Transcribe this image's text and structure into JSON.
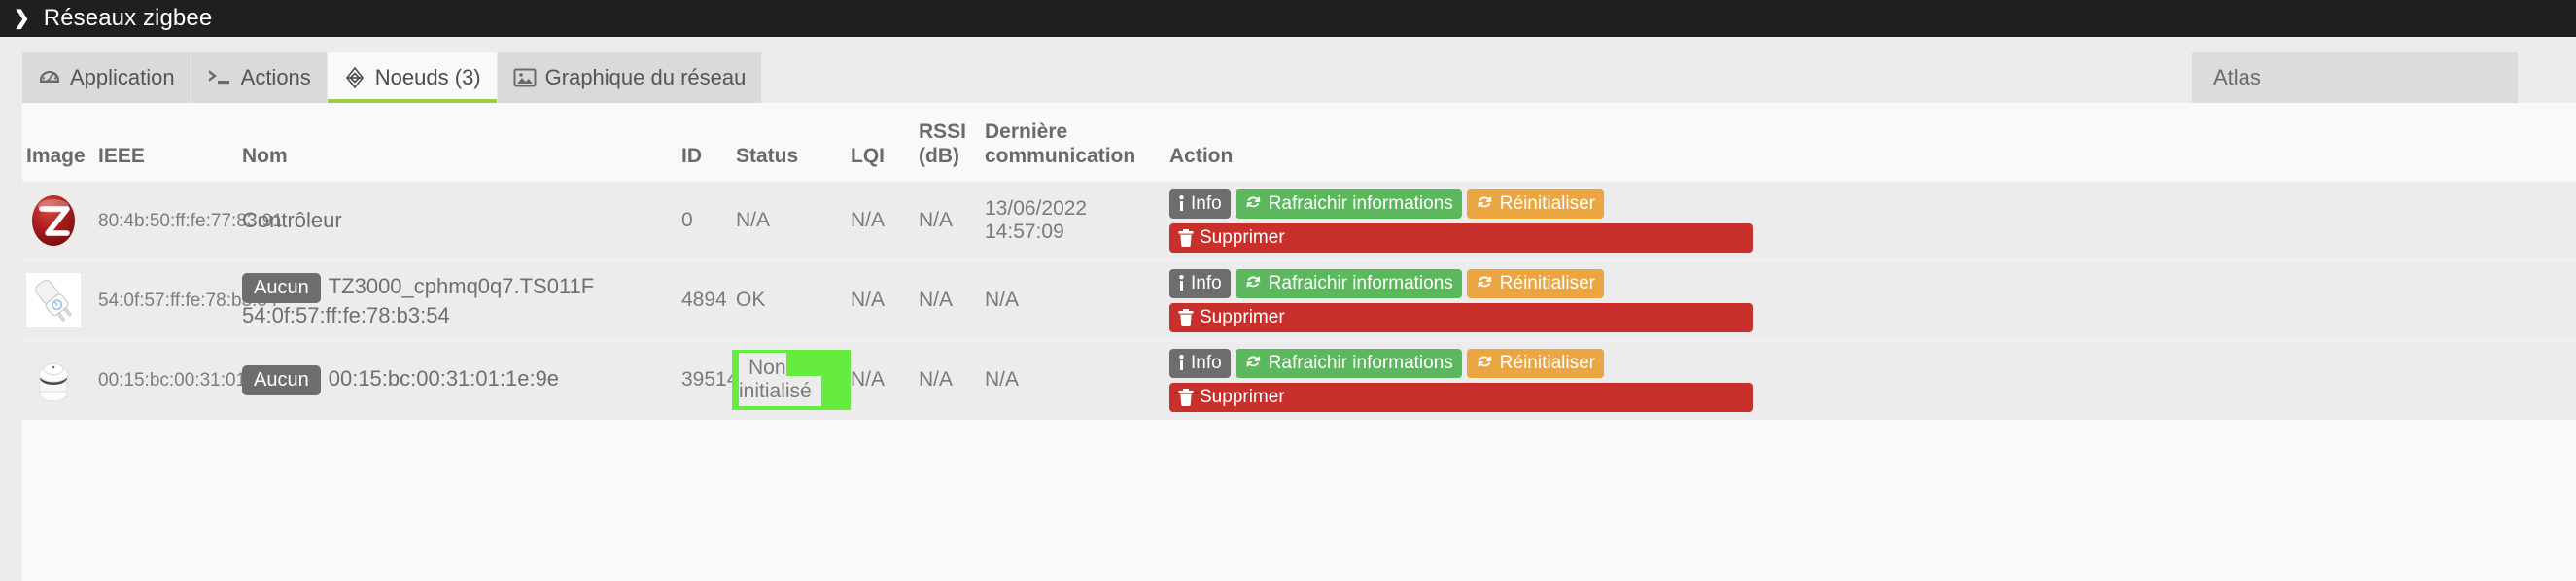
{
  "header": {
    "title": "Réseaux zigbee",
    "chevron_icon": "chevron-right-icon"
  },
  "tabs": [
    {
      "label": "Application",
      "icon": "dashboard-icon",
      "active": false
    },
    {
      "label": "Actions",
      "icon": "terminal-icon",
      "active": false
    },
    {
      "label": "Noeuds (3)",
      "icon": "zigbee-node-icon",
      "active": true
    },
    {
      "label": "Graphique du réseau",
      "icon": "image-icon",
      "active": false
    }
  ],
  "right_tab": {
    "label": "Atlas"
  },
  "table": {
    "columns": [
      "Image",
      "IEEE",
      "Nom",
      "ID",
      "Status",
      "LQI",
      "RSSI (dB)",
      "Dernière communication",
      "Action"
    ],
    "columns_multiline": {
      "rssi_line1": "RSSI",
      "rssi_line2": "(dB)",
      "last_line1": "Dernière",
      "last_line2": "communication"
    },
    "rows": [
      {
        "image_icon": "zigbee-logo-icon",
        "ieee": "80:4b:50:ff:fe:77:83:91",
        "badge": "",
        "name": "Contrôleur",
        "name_sub": "",
        "id": "0",
        "status": "N/A",
        "status_highlighted": false,
        "lqi": "N/A",
        "rssi": "N/A",
        "last_communication": "13/06/2022 14:57:09"
      },
      {
        "image_icon": "smart-plug-icon",
        "ieee": "54:0f:57:ff:fe:78:b3:54",
        "badge": "Aucun",
        "name": "TZ3000_cphmq0q7.TS011F",
        "name_sub": "54:0f:57:ff:fe:78:b3:54",
        "id": "4894",
        "status": "OK",
        "status_highlighted": false,
        "lqi": "N/A",
        "rssi": "N/A",
        "last_communication": "N/A"
      },
      {
        "image_icon": "smoke-sensor-icon",
        "ieee": "00:15:bc:00:31:01:1e:9e",
        "badge": "Aucun",
        "name": "00:15:bc:00:31:01:1e:9e",
        "name_sub": "",
        "id": "39514",
        "status": "Non initialisé",
        "status_highlighted": true,
        "lqi": "N/A",
        "rssi": "N/A",
        "last_communication": "N/A"
      }
    ],
    "action_buttons": {
      "info": "Info",
      "refresh": "Rafraichir informations",
      "reset": "Réinitialiser",
      "delete": "Supprimer",
      "info_icon": "info-icon",
      "refresh_icon": "refresh-icon",
      "reset_icon": "refresh-icon",
      "delete_icon": "trash-icon"
    }
  },
  "colors": {
    "topbar": "#1f1f1f",
    "active_tab_underline": "#9ccc4a",
    "highlight": "#66ec3e",
    "btn_info": "#6d6d6d",
    "btn_refresh": "#5cb85c",
    "btn_reset": "#eba641",
    "btn_delete": "#c9302c",
    "zigbee_logo": "#a81d1d"
  }
}
